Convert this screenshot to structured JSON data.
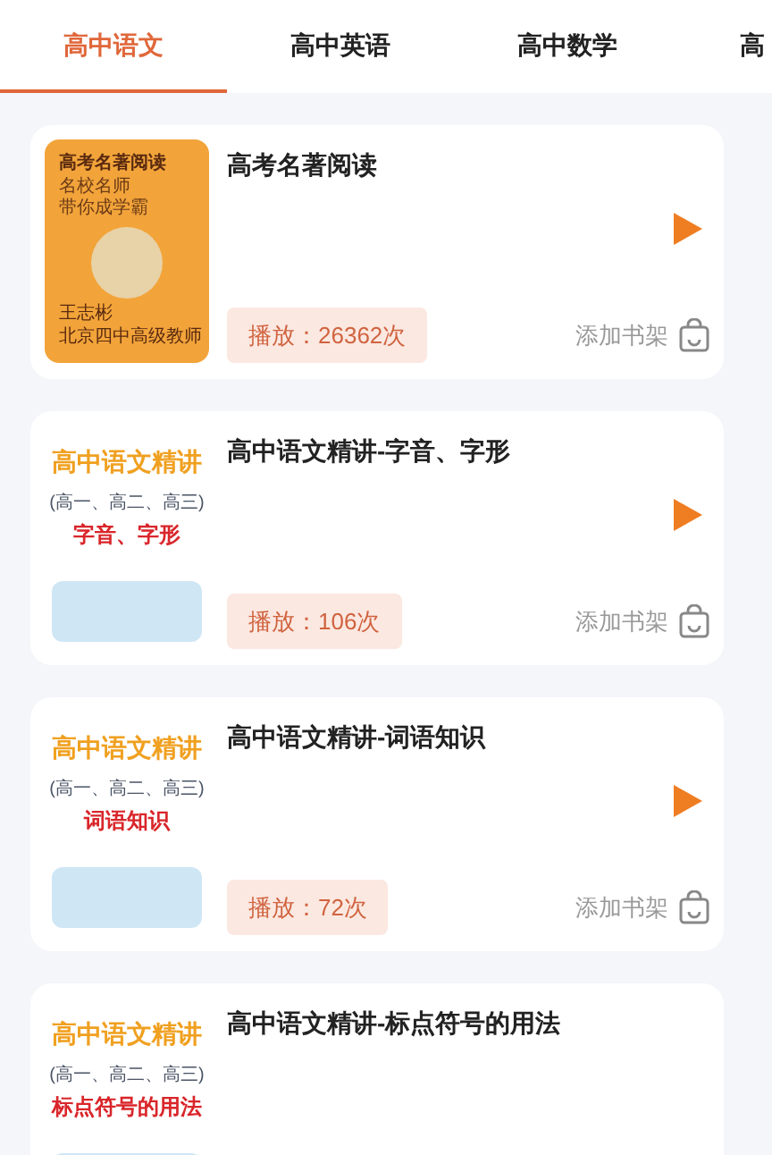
{
  "tabs": [
    {
      "label": "高中语文",
      "selected": true
    },
    {
      "label": "高中英语",
      "selected": false
    },
    {
      "label": "高中数学",
      "selected": false
    },
    {
      "label": "高",
      "selected": false
    }
  ],
  "courses": [
    {
      "title": "高考名著阅读",
      "cover": {
        "kind": "poster",
        "heading": "高考名著阅读",
        "lines": [
          "名校名师",
          "带你成学霸"
        ],
        "author": "王志彬",
        "author_title": "北京四中高级教师"
      },
      "plays": "播放：26362次",
      "shelf": "添加书架"
    },
    {
      "title": "高中语文精讲-字音、字形",
      "cover": {
        "kind": "series",
        "heading": "高中语文精讲",
        "grades": "(高一、高二、高三)",
        "topic": "字音、字形"
      },
      "plays": "播放：106次",
      "shelf": "添加书架"
    },
    {
      "title": "高中语文精讲-词语知识",
      "cover": {
        "kind": "series",
        "heading": "高中语文精讲",
        "grades": "(高一、高二、高三)",
        "topic": "词语知识"
      },
      "plays": "播放：72次",
      "shelf": "添加书架"
    },
    {
      "title": "高中语文精讲-标点符号的用法",
      "cover": {
        "kind": "series",
        "heading": "高中语文精讲",
        "grades": "(高一、高二、高三)",
        "topic": "标点符号的用法"
      }
    }
  ]
}
